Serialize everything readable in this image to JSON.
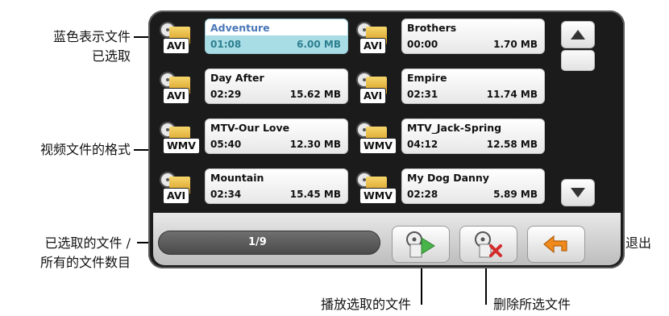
{
  "callouts": {
    "selected_blue_line1": "蓝色表示文件",
    "selected_blue_line2": "已选取",
    "format": "视频文件的格式",
    "count_line1": "已选取的文件 /",
    "count_line2": "所有的文件数目",
    "exit": "退出",
    "play": "播放选取的文件",
    "delete": "删除所选文件"
  },
  "files": [
    {
      "name": "Adventure",
      "duration": "01:08",
      "size": "6.00 MB",
      "format": "AVI",
      "selected": true
    },
    {
      "name": "Brothers",
      "duration": "00:00",
      "size": "1.70 MB",
      "format": "AVI",
      "selected": false
    },
    {
      "name": "Day After",
      "duration": "02:29",
      "size": "15.62 MB",
      "format": "AVI",
      "selected": false
    },
    {
      "name": "Empire",
      "duration": "02:31",
      "size": "11.74 MB",
      "format": "AVI",
      "selected": false
    },
    {
      "name": "MTV-Our Love",
      "duration": "05:40",
      "size": "12.30 MB",
      "format": "WMV",
      "selected": false
    },
    {
      "name": "MTV_Jack-Spring",
      "duration": "04:12",
      "size": "12.58 MB",
      "format": "WMV",
      "selected": false
    },
    {
      "name": "Mountain",
      "duration": "02:34",
      "size": "15.45 MB",
      "format": "AVI",
      "selected": false
    },
    {
      "name": "My Dog Danny",
      "duration": "02:28",
      "size": "5.89 MB",
      "format": "WMV",
      "selected": false
    }
  ],
  "pagination": {
    "current": 1,
    "total": 9,
    "label": "1/9"
  },
  "colors": {
    "selected_card": "#a8dde6",
    "selected_name": "#4a78b8",
    "screen_bg": "#1b1b1b",
    "play_green": "#49b44a",
    "delete_red": "#d42b2b",
    "exit_orange": "#f08a1c"
  },
  "icons": {
    "file": "film-reel-icon",
    "scroll_up": "triangle-up-icon",
    "scroll_down": "triangle-down-icon",
    "play": "play-icon",
    "delete": "delete-icon",
    "exit": "return-arrow-icon"
  }
}
